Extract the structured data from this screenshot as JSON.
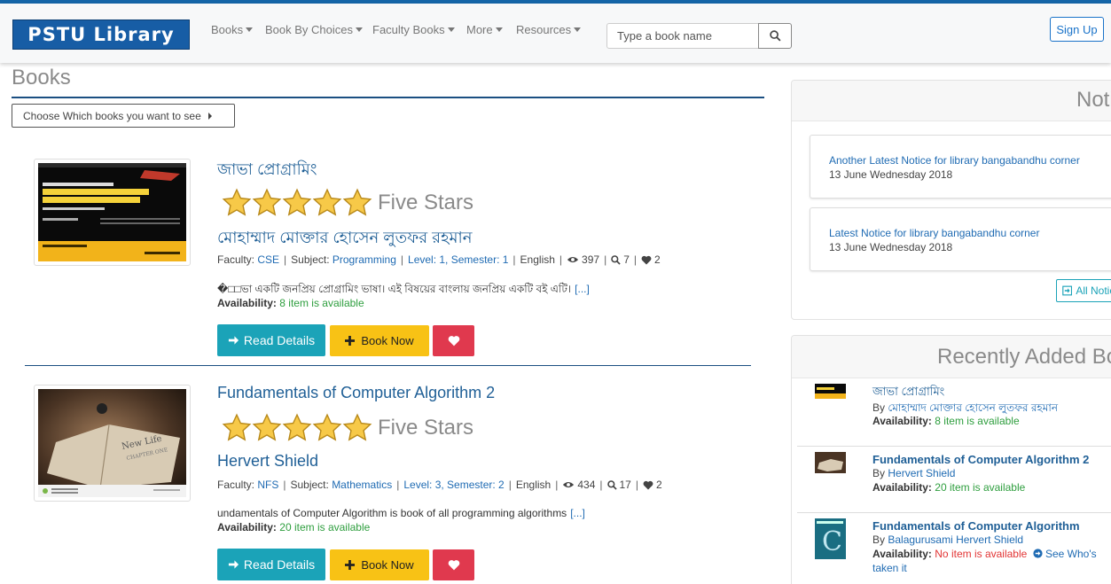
{
  "brand": "PSTU Library",
  "nav": [
    {
      "label": "Books"
    },
    {
      "label": "Book By Choices"
    },
    {
      "label": "Faculty Books"
    },
    {
      "label": "More"
    },
    {
      "label": "Resources"
    }
  ],
  "search": {
    "placeholder": "Type a book name"
  },
  "signup_label": "Sign Up",
  "page_title": "Books",
  "choose_label": "Choose Which books you want to see",
  "books": [
    {
      "title": "জাভা প্রোগ্রামিং",
      "rating": 5,
      "rating_label": "Five Stars",
      "author": "মোহাম্মাদ মোক্তার হোসেন লুতফর রহমান",
      "faculty_label": "Faculty:",
      "faculty": "CSE",
      "subject_label": "Subject:",
      "subject": "Programming",
      "level": "Level: 1, Semester: 1",
      "language": "English",
      "views": "397",
      "searches": "7",
      "likes": "2",
      "description": "�□□ভা একটি জনপ্রিয় প্রোগ্রামিং ভাষা। এই বিষয়ের বাংলায় জনপ্রিয় একটি বই এটি।",
      "more": "[...]",
      "availability_label": "Availability:",
      "availability": "8 item is available",
      "read_label": "Read Details",
      "book_label": "Book Now"
    },
    {
      "title": "Fundamentals of Computer Algorithm 2",
      "rating": 5,
      "rating_label": "Five Stars",
      "author": "Hervert Shield",
      "faculty_label": "Faculty:",
      "faculty": "NFS",
      "subject_label": "Subject:",
      "subject": "Mathematics",
      "level": "Level: 3, Semester: 2",
      "language": "English",
      "views": "434",
      "searches": "17",
      "likes": "2",
      "description": "undamentals of Computer Algorithm is book of all programming algorithms",
      "more": "[...]",
      "availability_label": "Availability:",
      "availability": "20 item is available",
      "read_label": "Read Details",
      "book_label": "Book Now"
    }
  ],
  "notices": {
    "title": "Notices",
    "items": [
      {
        "title": "Another Latest Notice for library bangabandhu corner",
        "date": "13 June Wednesday 2018"
      },
      {
        "title": "Latest Notice for library bangabandhu corner",
        "date": "13 June Wednesday 2018"
      }
    ],
    "all_label": "All Notices"
  },
  "recent": {
    "title": "Recently Added Books",
    "items": [
      {
        "title": "জাভা প্রোগ্রামিং",
        "by": "By",
        "author": "মোহাম্মাদ মোক্তার হোসেন লুতফর রহমান",
        "availability_label": "Availability:",
        "availability": "8 item is available"
      },
      {
        "title": "Fundamentals of Computer Algorithm 2",
        "by": "By",
        "author": "Hervert Shield",
        "availability_label": "Availability:",
        "availability": "20 item is available"
      },
      {
        "title": "Fundamentals of Computer Algorithm",
        "by": "By",
        "author": "Balagurusami Hervert Shield",
        "availability_label": "Availability:",
        "availability": "No item is available",
        "extra": "See Who's",
        "extra2": "taken it"
      }
    ]
  },
  "colors": {
    "brand": "#175da5",
    "info": "#1ba3b8",
    "warning": "#f8c215",
    "danger": "#e0394e",
    "link": "#1f6bb3",
    "success": "#2e9e3e"
  }
}
